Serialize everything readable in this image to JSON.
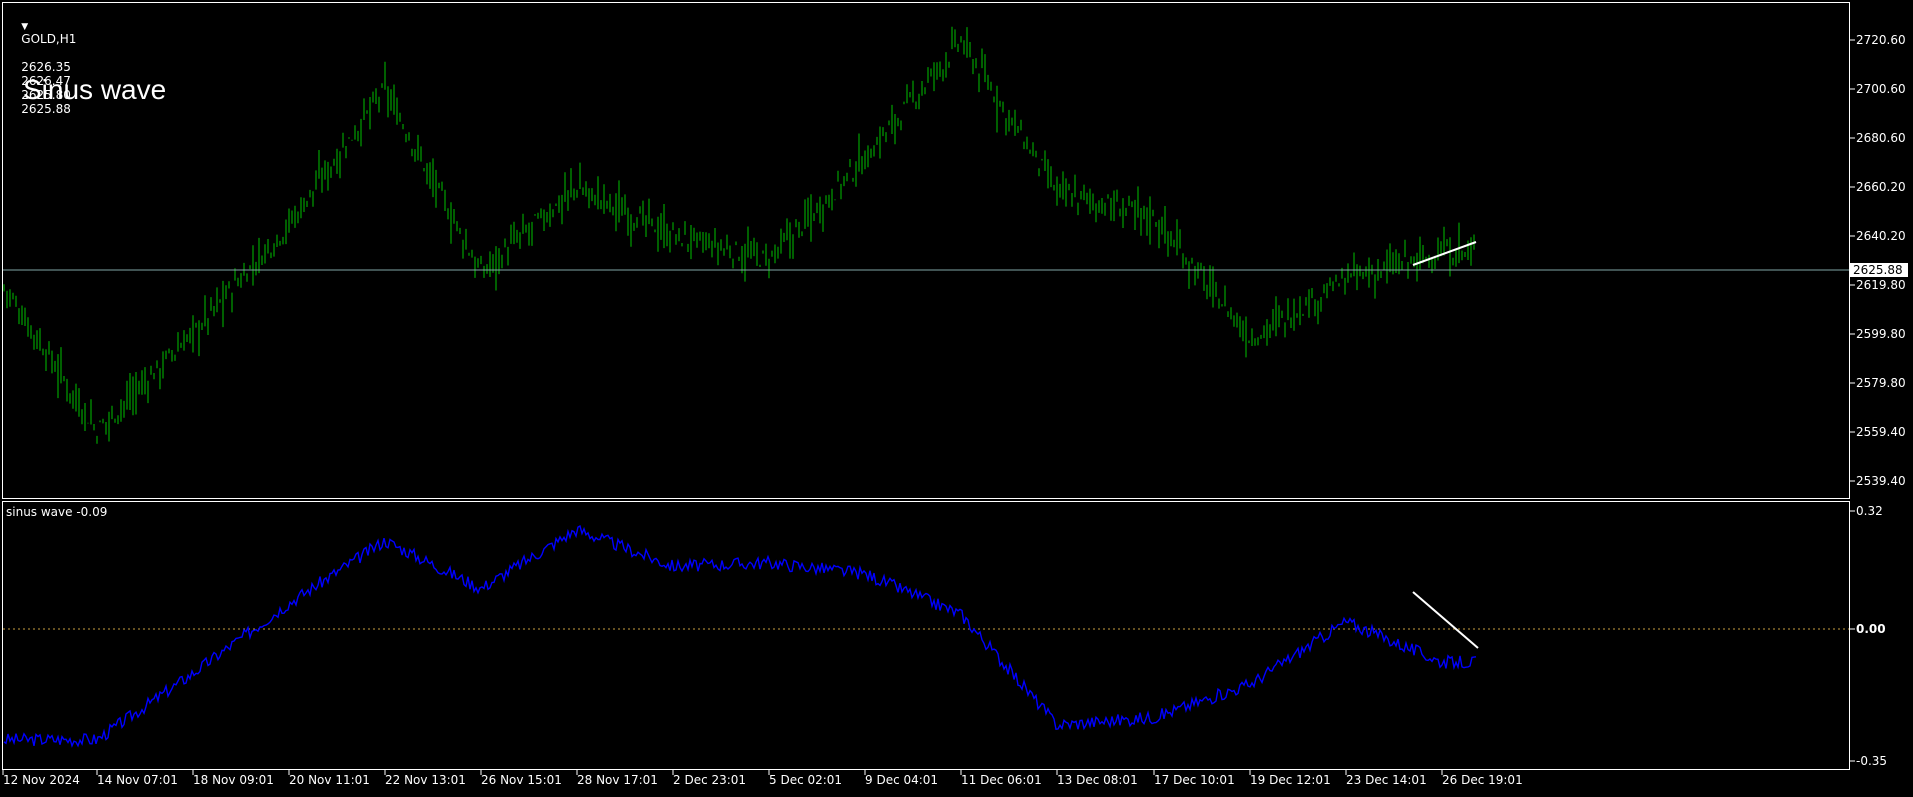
{
  "main_panel": {
    "header": {
      "symbol": "GOLD,H1",
      "open": "2626.35",
      "high": "2626.47",
      "low": "2625.80",
      "close": "2625.88"
    },
    "overlay_title": "Sinus wave",
    "current_price": "2625.88",
    "price_ticks": [
      "2720.60",
      "2700.60",
      "2680.60",
      "2660.20",
      "2640.20",
      "2619.80",
      "2599.80",
      "2579.80",
      "2559.40",
      "2539.40"
    ],
    "bar_color": "#00C000",
    "grid_line_color": "#7FA6A6",
    "trendline_color": "#FFFFFF"
  },
  "indicator_panel": {
    "label": "sinus wave -0.09",
    "ticks": [
      "0.32",
      "0.00",
      "-0.35"
    ],
    "line_color": "#0000FF",
    "zero_line_color": "#C8A040",
    "trendline_color": "#FFFFFF"
  },
  "time_axis": {
    "labels": [
      "12 Nov 2024",
      "14 Nov 07:01",
      "18 Nov 09:01",
      "20 Nov 11:01",
      "22 Nov 13:01",
      "26 Nov 15:01",
      "28 Nov 17:01",
      "2 Dec 23:01",
      "5 Dec 02:01",
      "9 Dec 04:01",
      "11 Dec 06:01",
      "13 Dec 08:01",
      "17 Dec 10:01",
      "19 Dec 12:01",
      "23 Dec 14:01",
      "26 Dec 19:01"
    ]
  },
  "chart_data": {
    "type": "line",
    "price_anchors": {
      "x_labels": [
        "12 Nov 2024",
        "14 Nov 07:01",
        "18 Nov 09:01",
        "20 Nov 11:01",
        "22 Nov 13:01",
        "26 Nov 15:01",
        "28 Nov 17:01",
        "2 Dec 23:01",
        "5 Dec 02:01",
        "9 Dec 04:01",
        "11 Dec 06:01",
        "13 Dec 08:01",
        "17 Dec 10:01",
        "19 Dec 12:01",
        "23 Dec 14:01",
        "26 Dec 19:01"
      ],
      "values": [
        2620,
        2560,
        2600,
        2645,
        2700,
        2625,
        2660,
        2640,
        2630,
        2672,
        2720,
        2658,
        2648,
        2598,
        2622,
        2633
      ]
    },
    "sinus_wave_anchors": {
      "values": [
        -0.3,
        -0.3,
        -0.12,
        0.07,
        0.24,
        0.11,
        0.27,
        0.17,
        0.18,
        0.15,
        0.04,
        -0.26,
        -0.24,
        -0.15,
        0.02,
        -0.09
      ]
    },
    "price_ylim": [
      2529.4,
      2730.6
    ],
    "indicator_ylim": [
      -0.35,
      0.32
    ]
  }
}
